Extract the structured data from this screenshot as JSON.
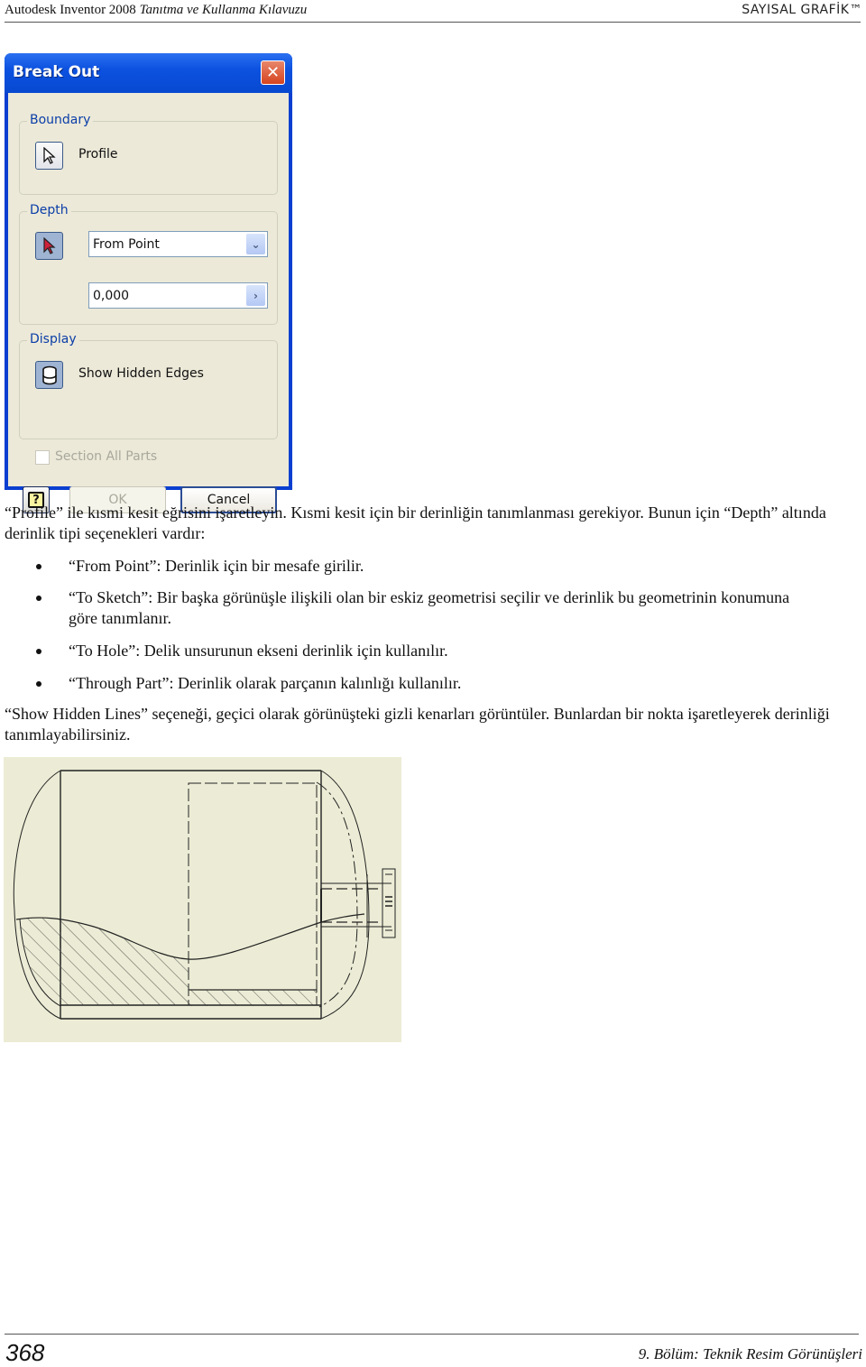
{
  "header": {
    "book_title_plain": "Autodesk Inventor 2008 ",
    "book_title_italic": "Tanıtma ve Kullanma Kılavuzu",
    "publisher": "SAYISAL GRAFİK™"
  },
  "dialog": {
    "title": "Break Out",
    "close_icon": "close-icon",
    "boundary": {
      "label": "Boundary",
      "profile_button_icon": "select-arrow-icon",
      "profile_label": "Profile"
    },
    "depth": {
      "label": "Depth",
      "select_button_icon": "select-arrow-red-icon",
      "type_selected": "From Point",
      "type_dropdown_icon": "chevron-down-icon",
      "distance_value": "0,000",
      "distance_arrow_icon": "chevron-right-icon"
    },
    "display": {
      "label": "Display",
      "hidden_edges_icon": "cylinder-icon",
      "hidden_edges_label": "Show Hidden Edges",
      "section_all_parts_label": "Section All Parts",
      "section_all_parts_checked": false
    },
    "buttons": {
      "help_icon": "help-icon",
      "help_glyph": "?",
      "ok": "OK",
      "cancel": "Cancel"
    }
  },
  "body": {
    "intro": "“Profile” ile kısmi kesit eğrisini işaretleyin. Kısmi kesit için bir derinliğin tanımlanması gerekiyor. Bunun için “Depth” altında derinlik tipi seçenekleri vardır:",
    "bullets": [
      "“From Point”: Derinlik için bir mesafe girilir.",
      "“To Sketch”: Bir başka görünüşle ilişkili olan bir eskiz geometrisi seçilir ve derinlik bu geometrinin konumuna göre tanımlanır.",
      "“To Hole”: Delik unsurunun ekseni derinlik için kullanılır.",
      "“Through Part”: Derinlik olarak parçanın kalınlığı kullanılır."
    ],
    "outro": "“Show Hidden Lines” seçeneği, geçici olarak görünüşteki gizli kenarları görüntüler. Bunlardan bir nokta işaretleyerek derinliği tanımlayabilirsiniz."
  },
  "figure": {
    "description": "break-out-section-drawing"
  },
  "footer": {
    "page_number": "368",
    "chapter": "9. Bölüm: Teknik Resim Görünüşleri"
  }
}
